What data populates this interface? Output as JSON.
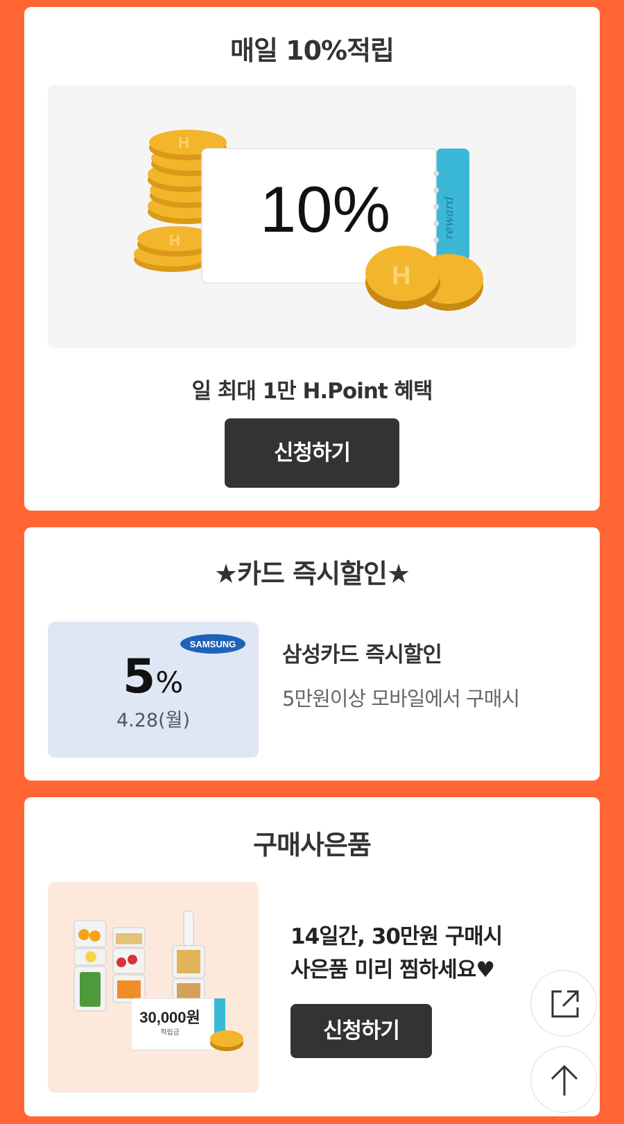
{
  "card1": {
    "title": "매일 10%적립",
    "ticket_percent": "10%",
    "ticket_stub_text": "reward",
    "subline": "일 최대 1만 H.Point 혜택",
    "button_label": "신청하기"
  },
  "card2": {
    "title": "★카드 즉시할인★",
    "logo_text": "SAMSUNG",
    "discount_number": "5",
    "discount_symbol": "%",
    "discount_date": "4.28(월)",
    "heading": "삼성카드 즉시할인",
    "description": "5만원이상 모바일에서 구매시"
  },
  "card3": {
    "title": "구매사은품",
    "voucher_amount": "30,000원",
    "voucher_caption": "적립금",
    "line1": "14일간, 30만원 구매시",
    "line2": "사은품 미리 찜하세요♥",
    "button_label": "신청하기"
  },
  "floating": {
    "share_icon": "share-icon",
    "top_icon": "arrow-up-icon"
  },
  "colors": {
    "background": "#FF6633",
    "button": "#333333",
    "coin": "#F2B52C",
    "ticket_stub": "#3BB8D8",
    "samsung_blue": "#1E63B8"
  }
}
